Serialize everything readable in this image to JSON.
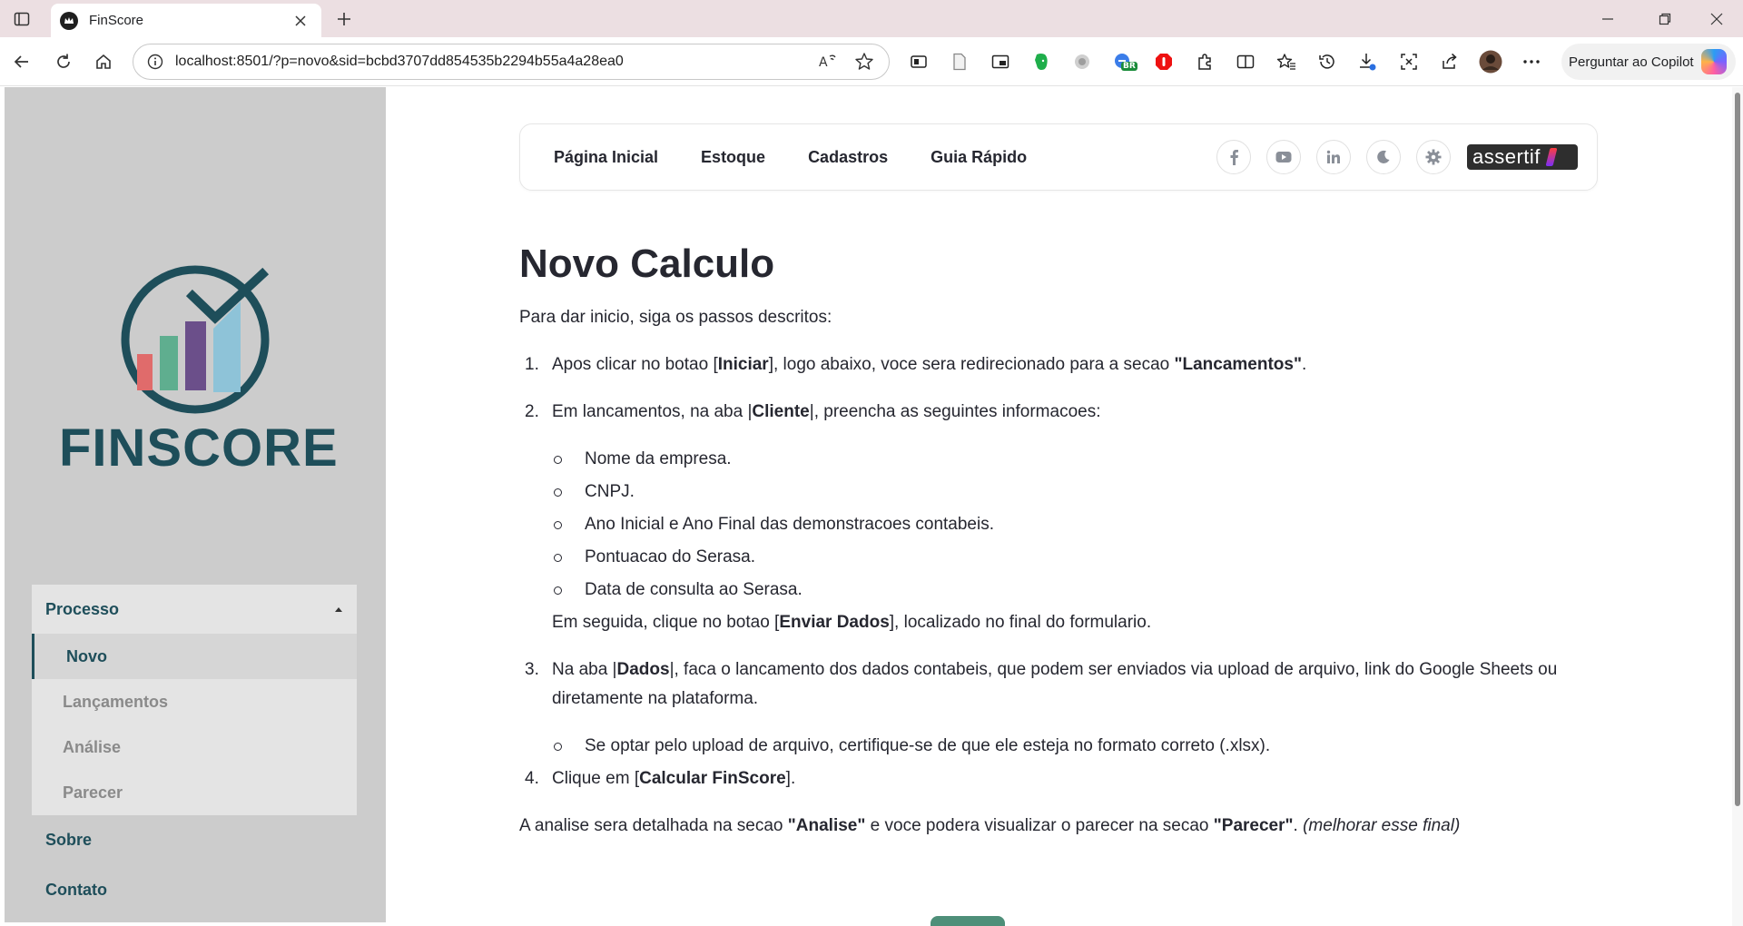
{
  "browser": {
    "tab_title": "FinScore",
    "url": "localhost:8501/?p=novo&sid=bcbd3707dd854535b2294b55a4a28ea0",
    "copilot_label": "Perguntar ao Copilot",
    "badge_text": "BR"
  },
  "sidebar": {
    "logo_text": "FINSCORE",
    "menu": {
      "group_label": "Processo",
      "items": [
        "Novo",
        "Lançamentos",
        "Análise",
        "Parecer"
      ],
      "active_index": 0,
      "extra": [
        "Sobre",
        "Contato"
      ]
    }
  },
  "topnav": {
    "links": [
      "Página Inicial",
      "Estoque",
      "Cadastros",
      "Guia Rápido"
    ],
    "brand": "assertif"
  },
  "content": {
    "title": "Novo Calculo",
    "intro": "Para dar inicio, siga os passos descritos:",
    "step1": {
      "num": "1.",
      "t1": "Apos clicar no botao [",
      "b1": "Iniciar",
      "t2": "], logo abaixo, voce sera redirecionado para a secao ",
      "b2": "\"Lancamentos\"",
      "t3": "."
    },
    "step2": {
      "num": "2.",
      "t1": "Em lancamentos, na aba |",
      "b1": "Cliente",
      "t2": "|, preencha as seguintes informacoes:",
      "bullets": [
        "Nome da empresa.",
        "CNPJ.",
        "Ano Inicial e Ano Final das demonstracoes contabeis.",
        "Pontuacao do Serasa.",
        "Data de consulta ao Serasa."
      ],
      "after_t1": "Em seguida, clique no botao [",
      "after_b1": "Enviar Dados",
      "after_t2": "], localizado no final do formulario."
    },
    "step3": {
      "num": "3.",
      "t1": "Na aba |",
      "b1": "Dados",
      "t2": "|, faca o lancamento dos dados contabeis, que podem ser enviados via upload de arquivo, link do Google Sheets ou diretamente na plataforma.",
      "bullet": "Se optar pelo upload de arquivo, certifique-se de que ele esteja no formato correto (.xlsx)."
    },
    "step4": {
      "num": "4.",
      "t1": "Clique em [",
      "b1": "Calcular FinScore",
      "t2": "]."
    },
    "closing": {
      "t1": "A analise sera detalhada na secao ",
      "b1": "\"Analise\"",
      "t2": " e voce podera visualizar o parecer na secao ",
      "b2": "\"Parecer\"",
      "t3": ". ",
      "i1": "(melhorar esse final)"
    }
  },
  "colors": {
    "brand_teal": "#1e4e5a",
    "sidebar_bg": "#cccccc",
    "bar_red": "#e06b6b",
    "bar_green": "#5fae8f",
    "bar_purple": "#6b4f8a",
    "bar_blue": "#8ec3d8",
    "button_green": "#4e8f79"
  },
  "icons": {
    "tab_favicon": "crown-icon",
    "browser_actions": [
      "read-aloud-icon",
      "favorite-star-icon"
    ],
    "extensions": [
      "wallet-icon",
      "document-icon",
      "picture-in-picture-icon",
      "evernote-icon",
      "extension-leaf-icon",
      "translate-icon",
      "adblock-icon",
      "puzzle-icon",
      "split-screen-icon",
      "favorites-icon",
      "history-icon",
      "download-icon",
      "screenshot-icon",
      "share-icon",
      "profile-avatar",
      "more-icon"
    ],
    "social": [
      "facebook-icon",
      "youtube-icon",
      "linkedin-icon",
      "moon-icon",
      "gear-icon"
    ]
  }
}
